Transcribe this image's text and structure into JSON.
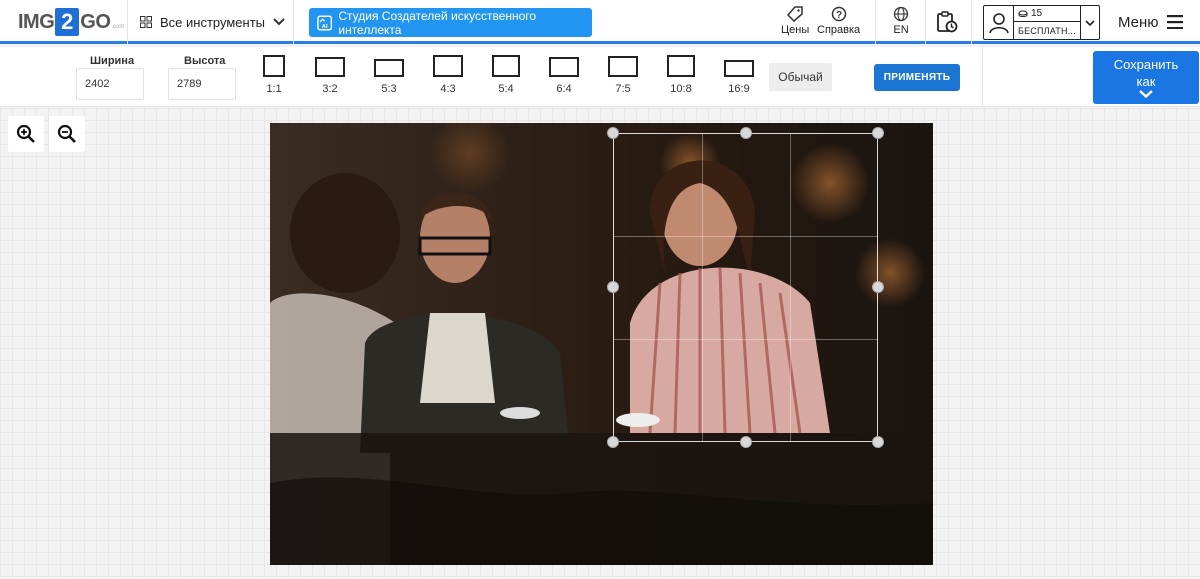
{
  "header": {
    "logo": {
      "left": "IMG",
      "mid": "2",
      "right": "GO",
      "small": ".com"
    },
    "tools_label": "Все инструменты",
    "ai_studio_label": "Студия Создателей искусственного интеллекта",
    "prices_label": "Цены",
    "help_label": "Справка",
    "language": "EN",
    "user": {
      "credits": "15",
      "plan": "БЕСПЛАТН..."
    },
    "menu_label": "Меню"
  },
  "toolbar": {
    "width_label": "Ширина",
    "width_value": "2402",
    "height_label": "Высота",
    "height_value": "2789",
    "ratios": [
      "1:1",
      "3:2",
      "5:3",
      "4:3",
      "5:4",
      "6:4",
      "7:5",
      "10:8",
      "16:9"
    ],
    "normal_label": "Обычай",
    "apply_label": "ПРИМЕНЯТЬ",
    "save_label_line1": "Сохранить",
    "save_label_line2": "как"
  },
  "colors": {
    "accent": "#2a7de1",
    "primary_button": "#1a76d2",
    "ai_button": "#2295f0"
  },
  "icons": [
    "grid-icon",
    "chevron-down-icon",
    "ai-studio-icon",
    "tag-icon",
    "help-icon",
    "globe-icon",
    "clipboard-clock-icon",
    "user-icon",
    "coin-icon",
    "hamburger-icon",
    "zoom-in-icon",
    "zoom-out-icon"
  ]
}
